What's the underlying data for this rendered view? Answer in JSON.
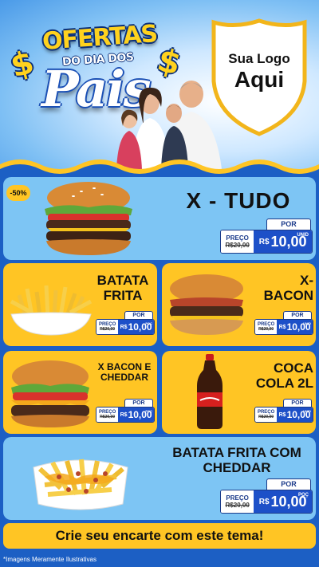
{
  "header": {
    "promo_line1": "OFERTAS",
    "promo_line2": "DO DIA DOS",
    "promo_line3": "Pais",
    "dollar": "$",
    "logo_line1": "Sua Logo",
    "logo_line2": "Aqui"
  },
  "colors": {
    "background_blue": "#1c5fc4",
    "card_yellow": "#ffc524",
    "price_blue": "#1d50c8"
  },
  "products": [
    {
      "name": "X - TUDO",
      "discount": "-50%",
      "por_label": "POR",
      "preco_label": "PREÇO",
      "old_price": "R$20,00",
      "currency": "R$",
      "price": "10,00",
      "unit": "UNID",
      "icon": "burger-icon"
    },
    {
      "name_line1": "BATATA",
      "name_line2": "FRITA",
      "por_label": "POR",
      "preco_label": "PREÇO",
      "old_price": "R$20,00",
      "currency": "R$",
      "price": "10,00",
      "unit": "POÇ",
      "icon": "fries-icon"
    },
    {
      "name_line1": "X-",
      "name_line2": "BACON",
      "por_label": "POR",
      "preco_label": "PREÇO",
      "old_price": "R$20,00",
      "currency": "R$",
      "price": "10,00",
      "unit": "UNID",
      "icon": "bacon-burger-icon"
    },
    {
      "name_line1": "X BACON E",
      "name_line2": "CHEDDAR",
      "por_label": "POR",
      "preco_label": "PREÇO",
      "old_price": "R$20,00",
      "currency": "R$",
      "price": "10,00",
      "unit": "POÇ",
      "icon": "cheddar-burger-icon"
    },
    {
      "name_line1": "COCA",
      "name_line2": "COLA 2L",
      "por_label": "POR",
      "preco_label": "PREÇO",
      "old_price": "R$20,00",
      "currency": "R$",
      "price": "10,00",
      "unit": "UNID",
      "icon": "soda-bottle-icon"
    },
    {
      "name_line1": "BATATA FRITA COM",
      "name_line2": "CHEDDAR",
      "por_label": "POR",
      "preco_label": "PREÇO",
      "old_price": "R$20,00",
      "currency": "R$",
      "price": "10,00",
      "unit": "POÇ",
      "icon": "cheddar-fries-icon"
    }
  ],
  "cta": "Crie seu encarte com este tema!",
  "disclaimer": "*Imagens Meramente Ilustrativas"
}
